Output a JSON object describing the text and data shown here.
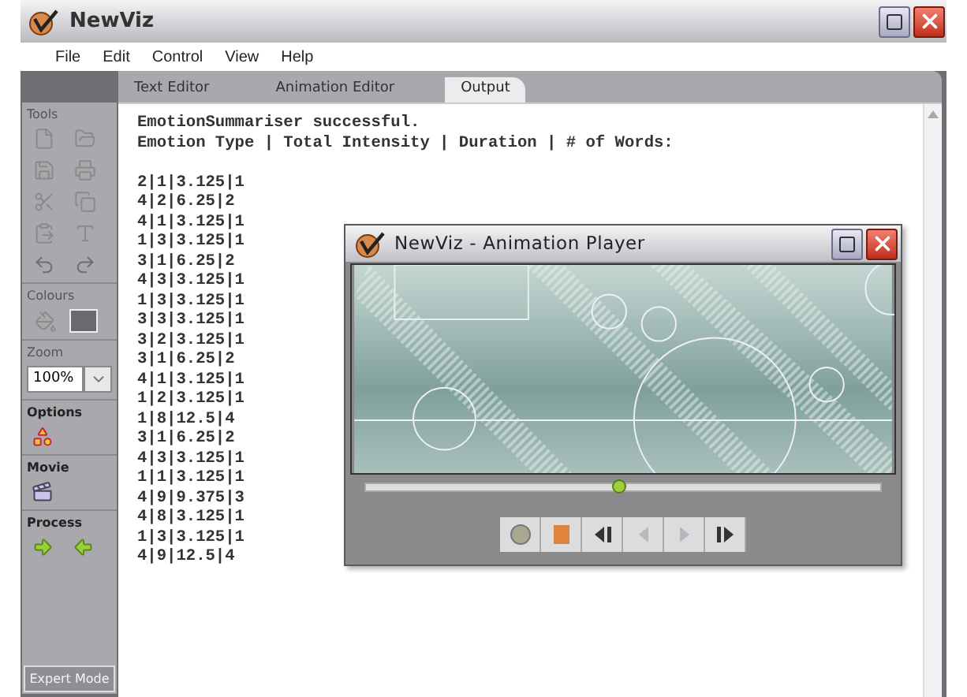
{
  "window": {
    "title": "NewViz"
  },
  "menu": [
    "File",
    "Edit",
    "Control",
    "View",
    "Help"
  ],
  "tabs": [
    {
      "label": "Text Editor",
      "selected": false
    },
    {
      "label": "Animation Editor",
      "selected": false
    },
    {
      "label": "Output",
      "selected": true
    }
  ],
  "sidebar": {
    "sections": [
      {
        "kind": "tools",
        "title": "Tools"
      },
      {
        "kind": "colours",
        "title": "Colours"
      },
      {
        "kind": "zoom",
        "title": "Zoom",
        "value": "100%"
      },
      {
        "kind": "options",
        "title": "Options"
      },
      {
        "kind": "movie",
        "title": "Movie"
      },
      {
        "kind": "process",
        "title": "Process"
      }
    ],
    "expert_button": "Expert Mode"
  },
  "output": {
    "header": [
      "EmotionSummariser successful.",
      "Emotion Type | Total Intensity | Duration | # of Words:"
    ],
    "lines": [
      "2|1|3.125|1",
      "4|2|6.25|2",
      "4|1|3.125|1",
      "1|3|3.125|1",
      "3|1|6.25|2",
      "4|3|3.125|1",
      "1|3|3.125|1",
      "3|3|3.125|1",
      "3|2|3.125|1",
      "3|1|6.25|2",
      "4|1|3.125|1",
      "1|2|3.125|1",
      "1|8|12.5|4",
      "3|1|6.25|2",
      "4|3|3.125|1",
      "1|1|3.125|1",
      "4|9|9.375|3",
      "4|8|3.125|1",
      "1|3|3.125|1",
      "4|9|12.5|4"
    ]
  },
  "player": {
    "title": "NewViz - Animation Player",
    "timeline": {
      "level": 0.49
    },
    "controls": [
      {
        "kind": "record",
        "disabled": false
      },
      {
        "kind": "stop",
        "disabled": false
      },
      {
        "kind": "step-back",
        "disabled": false
      },
      {
        "kind": "prev",
        "disabled": true
      },
      {
        "kind": "next",
        "disabled": true
      },
      {
        "kind": "step-forward",
        "disabled": false
      }
    ]
  }
}
